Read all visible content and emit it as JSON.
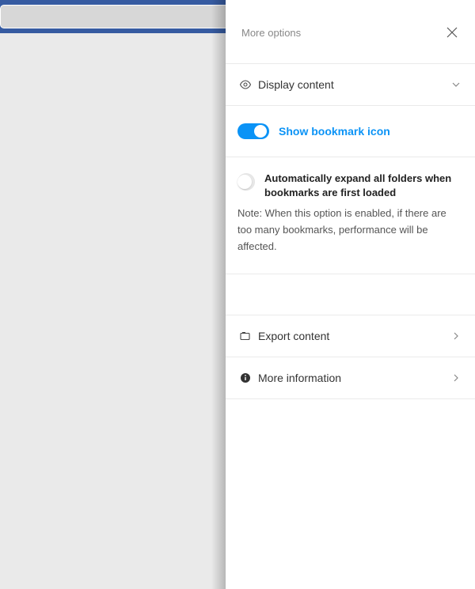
{
  "panel": {
    "title": "More options",
    "display_content": {
      "label": "Display content"
    },
    "show_bookmark_icon": {
      "label": "Show bookmark icon",
      "enabled": true
    },
    "auto_expand": {
      "label": "Automatically expand all folders when bookmarks are first loaded",
      "enabled": false,
      "note": "Note: When this option is enabled, if there are too many bookmarks, performance will be affected."
    },
    "export_content": {
      "label": "Export content"
    },
    "more_information": {
      "label": "More information"
    }
  }
}
